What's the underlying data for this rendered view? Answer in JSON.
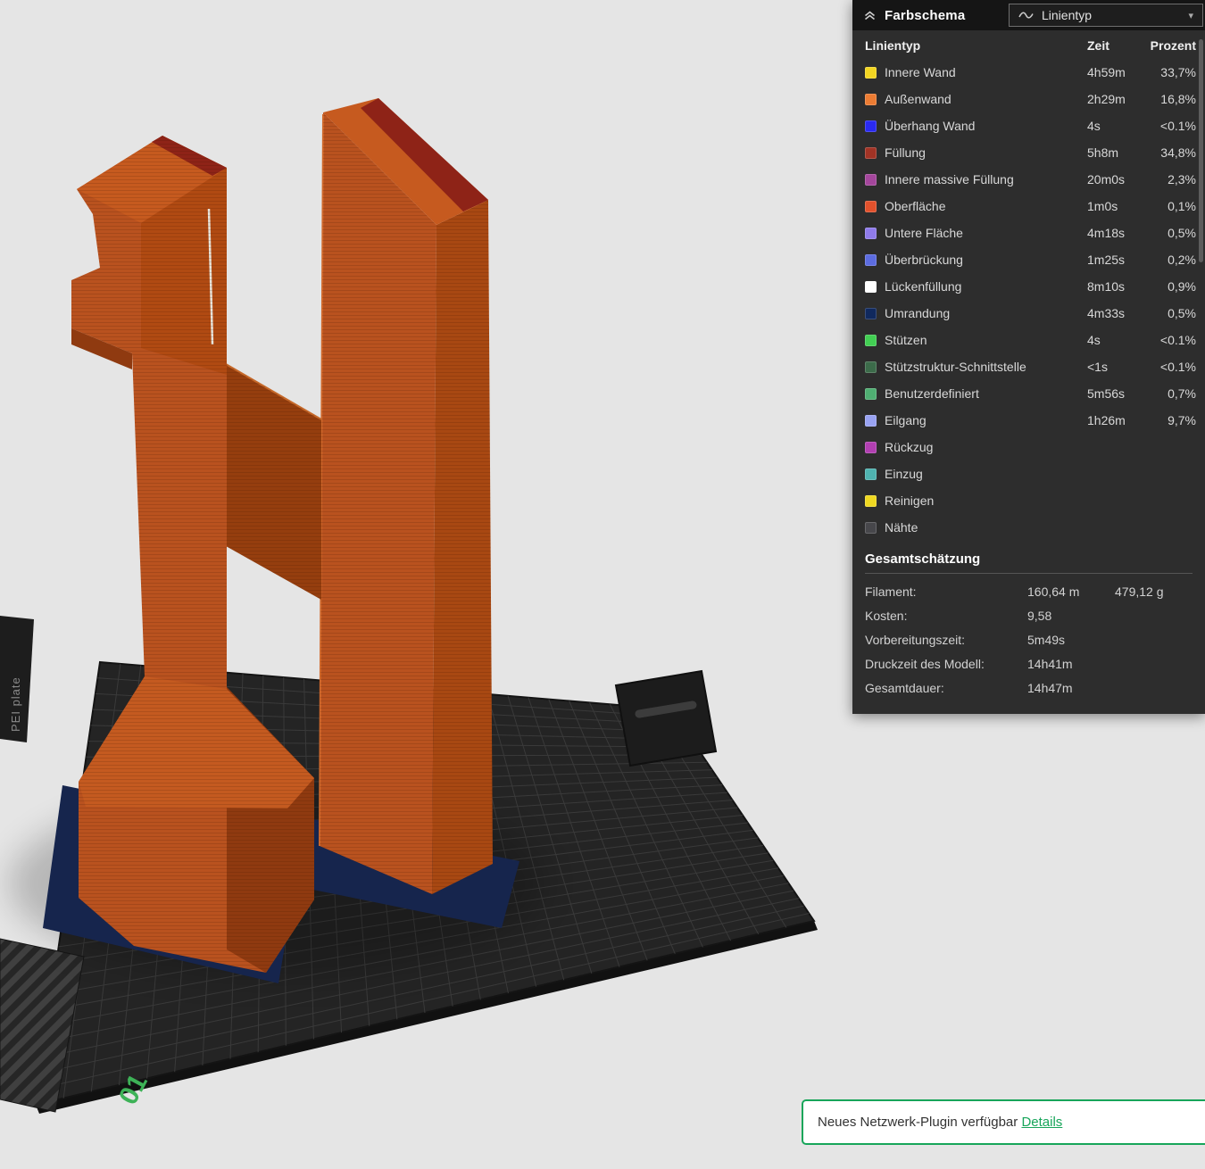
{
  "panel": {
    "title": "Farbschema",
    "dropdown_value": "Linientyp",
    "columns": {
      "type": "Linientyp",
      "time": "Zeit",
      "percent": "Prozent"
    },
    "line_types": [
      {
        "label": "Innere Wand",
        "color": "#f2d522",
        "time": "4h59m",
        "percent": "33,7%"
      },
      {
        "label": "Außenwand",
        "color": "#ec7c33",
        "time": "2h29m",
        "percent": "16,8%"
      },
      {
        "label": "Überhang Wand",
        "color": "#2a2af0",
        "time": "4s",
        "percent": "<0.1%"
      },
      {
        "label": "Füllung",
        "color": "#a13325",
        "time": "5h8m",
        "percent": "34,8%"
      },
      {
        "label": "Innere massive Füllung",
        "color": "#a4469c",
        "time": "20m0s",
        "percent": "2,3%"
      },
      {
        "label": "Oberfläche",
        "color": "#e2512c",
        "time": "1m0s",
        "percent": "0,1%"
      },
      {
        "label": "Untere Fläche",
        "color": "#8f7bea",
        "time": "4m18s",
        "percent": "0,5%"
      },
      {
        "label": "Überbrückung",
        "color": "#5c6ce0",
        "time": "1m25s",
        "percent": "0,2%"
      },
      {
        "label": "Lückenfüllung",
        "color": "#ffffff",
        "time": "8m10s",
        "percent": "0,9%"
      },
      {
        "label": "Umrandung",
        "color": "#10295e",
        "time": "4m33s",
        "percent": "0,5%"
      },
      {
        "label": "Stützen",
        "color": "#42cf53",
        "time": "4s",
        "percent": "<0.1%"
      },
      {
        "label": "Stützstruktur-Schnittstelle",
        "color": "#3c6b4a",
        "time": "<1s",
        "percent": "<0.1%"
      },
      {
        "label": "Benutzerdefiniert",
        "color": "#4fae72",
        "time": "5m56s",
        "percent": "0,7%"
      },
      {
        "label": "Eilgang",
        "color": "#99a3f2",
        "time": "1h26m",
        "percent": "9,7%"
      },
      {
        "label": "Rückzug",
        "color": "#b13fb1",
        "time": "",
        "percent": ""
      },
      {
        "label": "Einzug",
        "color": "#4fb3b0",
        "time": "",
        "percent": ""
      },
      {
        "label": "Reinigen",
        "color": "#efd821",
        "time": "",
        "percent": ""
      },
      {
        "label": "Nähte",
        "color": "#47474b",
        "time": "",
        "percent": ""
      }
    ],
    "summary": {
      "title": "Gesamtschätzung",
      "rows": [
        {
          "label": "Filament:",
          "value": "160,64 m",
          "value2": "479,12 g"
        },
        {
          "label": "Kosten:",
          "value": "9,58",
          "value2": ""
        },
        {
          "label": "Vorbereitungszeit:",
          "value": "5m49s",
          "value2": ""
        },
        {
          "label": "Druckzeit des Modell:",
          "value": "14h41m",
          "value2": ""
        },
        {
          "label": "Gesamtdauer:",
          "value": "14h47m",
          "value2": ""
        }
      ]
    }
  },
  "viewport": {
    "plate_label": "PEI plate",
    "plate_marker": "01"
  },
  "notification": {
    "text": "Neues Netzwerk-Plugin verfügbar",
    "link_label": "Details"
  },
  "colors": {
    "accent_green": "#17a55a",
    "model_orange": "#b9521f",
    "brim_navy": "#16254d"
  }
}
